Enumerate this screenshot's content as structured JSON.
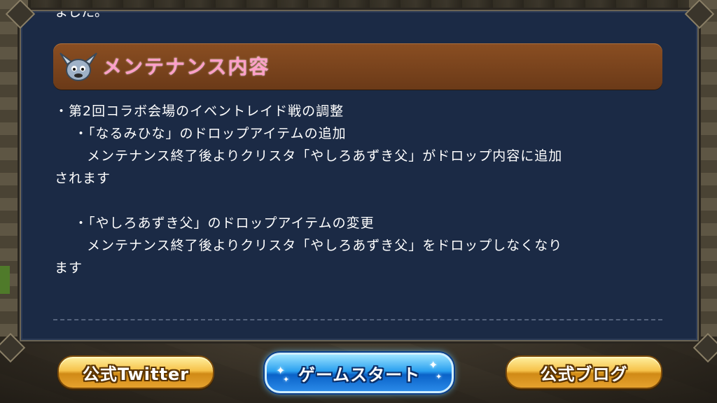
{
  "notice": {
    "cut_text": "ました。",
    "section_title": "メンテナンス内容",
    "lines": [
      "・第2回コラボ会場のイベントレイド戦の調整",
      "・「なるみひな」のドロップアイテムの追加",
      "メンテナンス終了後よりクリスタ「やしろあずき父」がドロップ内容に追加",
      "されます",
      "",
      "・「やしろあずき父」のドロップアイテムの変更",
      "メンテナンス終了後よりクリスタ「やしろあずき父」をドロップしなくなり",
      "ます"
    ]
  },
  "buttons": {
    "twitter": "公式Twitter",
    "start": "ゲームスタート",
    "blog": "公式ブログ"
  },
  "icons": {
    "mascot": "mascot-icon",
    "sparkle": "sparkle-icon"
  },
  "colors": {
    "panel_bg": "#1b2a45",
    "header_bg": "#7a4420",
    "title_pink": "#ff9fc8",
    "button_gold": "#f0b63a",
    "button_blue": "#1a86e6"
  }
}
